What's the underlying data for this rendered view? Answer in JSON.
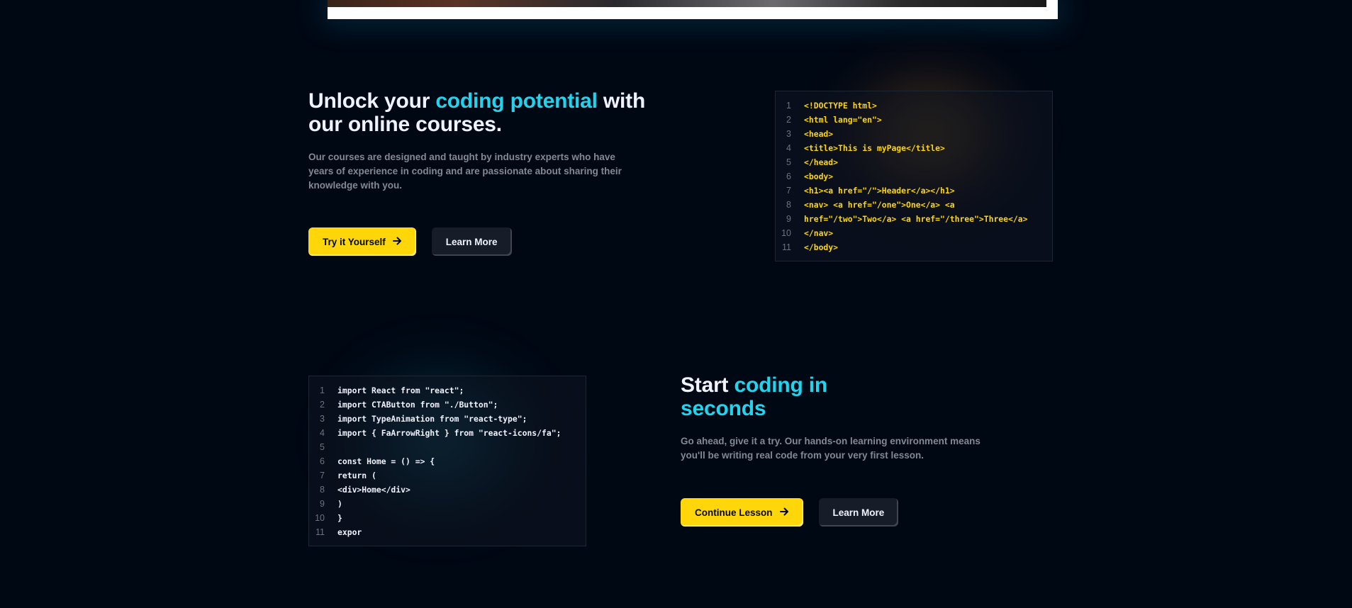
{
  "section1": {
    "heading_pre": "Unlock your ",
    "heading_highlight": "coding potential",
    "heading_post": " with our online courses.",
    "subtext": "Our courses are designed and taught by industry experts who have years of experience in coding and are passionate about sharing their knowledge with you.",
    "primary_button": "Try it Yourself",
    "secondary_button": "Learn More",
    "code_lines": [
      "<!DOCTYPE html>",
      "<html lang=\"en\">",
      "<head>",
      "<title>This is myPage</title>",
      "</head>",
      "<body>",
      "<h1><a href=\"/\">Header</a></h1>",
      "<nav> <a href=\"/one\">One</a> <a",
      "href=\"/two\">Two</a> <a href=\"/three\">Three</a>",
      "</nav>",
      "</body>"
    ],
    "code_color": "#FFD60A"
  },
  "section2": {
    "heading_pre": "Start ",
    "heading_highlight": "coding in seconds",
    "subtext": "Go ahead, give it a try. Our hands-on learning environment means you'll be writing real code from your very first lesson.",
    "primary_button": "Continue Lesson",
    "secondary_button": "Learn More",
    "code_lines": [
      "import React from \"react\";",
      "import CTAButton from \"./Button\";",
      "import TypeAnimation from \"react-type\";",
      "import { FaArrowRight } from \"react-icons/fa\";",
      "",
      "const Home = () => {",
      "return (",
      "<div>Home</div>",
      ")",
      "}",
      "expor"
    ],
    "code_color": "#F1F2FF"
  },
  "line_numbers": [
    "1",
    "2",
    "3",
    "4",
    "5",
    "6",
    "7",
    "8",
    "9",
    "10",
    "11"
  ],
  "icons": {
    "arrow": "arrow-right-icon"
  },
  "colors": {
    "background": "#000814",
    "accent_yellow": "#FFD60A",
    "highlight_cyan": "#22D3EE",
    "muted_text": "#838894",
    "dark_button": "#161D29"
  }
}
